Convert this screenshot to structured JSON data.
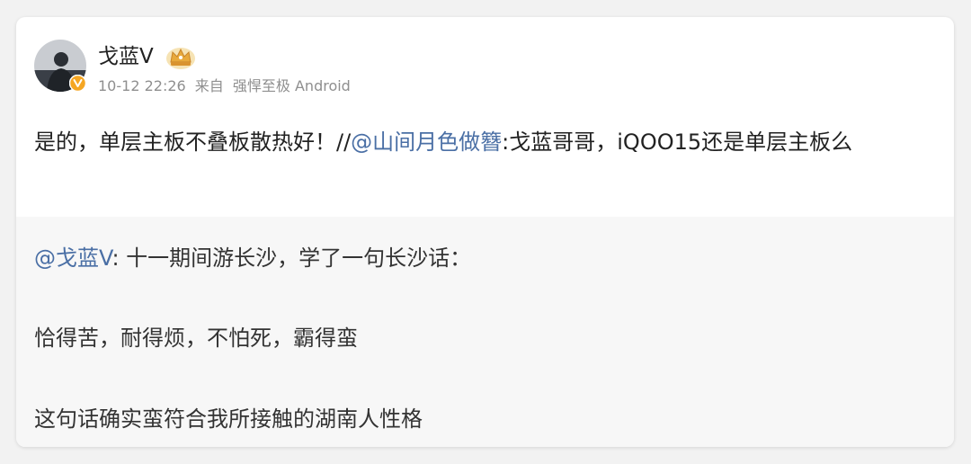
{
  "post": {
    "username": "戈蓝V",
    "time": "10-12 22:26",
    "source_prefix": "来自",
    "source": "强悍至极 Android",
    "text_before": "是的，单层主板不叠板散热好！//",
    "mention": "@山间月色做簪",
    "text_after": ":戈蓝哥哥，iQOO15还是单层主板么"
  },
  "repost": {
    "mention": "@戈蓝V",
    "line1_rest": ": 十一期间游长沙，学了一句长沙话：",
    "line2": "恰得苦，耐得烦，不怕死，霸得蛮",
    "line3": "这句话确实蛮符合我所接触的湖南人性格"
  },
  "icons": {
    "avatar": "avatar-photo",
    "verified": "verified-badge-icon",
    "crown": "crown-badge-icon"
  },
  "colors": {
    "mention": "#4a6fa5",
    "verified": "#f5a623",
    "meta": "#8f8f8f",
    "repost_bg": "#f7f7f7"
  }
}
